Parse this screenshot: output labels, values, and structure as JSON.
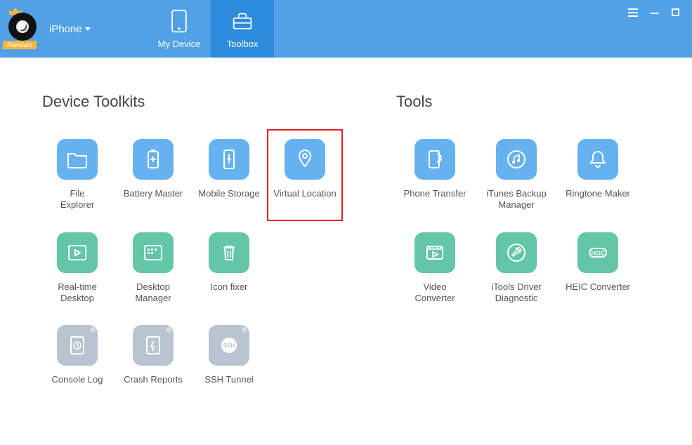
{
  "header": {
    "premium_badge": "Premium",
    "device_label": "iPhone",
    "tabs": {
      "my_device": "My Device",
      "toolbox": "Toolbox"
    }
  },
  "sections": {
    "device_toolkits_title": "Device Toolkits",
    "tools_title": "Tools"
  },
  "device_toolkits": {
    "file_explorer": "File\nExplorer",
    "battery_master": "Battery Master",
    "mobile_storage": "Mobile Storage",
    "virtual_location": "Virtual Location",
    "real_time_desktop": "Real-time\nDesktop",
    "desktop_manager": "Desktop\nManager",
    "icon_fixer": "Icon fixer",
    "console_log": "Console Log",
    "crash_reports": "Crash Reports",
    "ssh_tunnel": "SSH Tunnel"
  },
  "tools": {
    "phone_transfer": "Phone Transfer",
    "itunes_backup_manager": "iTunes Backup\nManager",
    "ringtone_maker": "Ringtone Maker",
    "video_converter": "Video\nConverter",
    "itools_driver_diagnostic": "iTools Driver\nDiagnostic",
    "heic_converter": "HEIC Converter"
  },
  "icons": {
    "ssh_label": "SSH",
    "heic_label": "HEIC"
  }
}
